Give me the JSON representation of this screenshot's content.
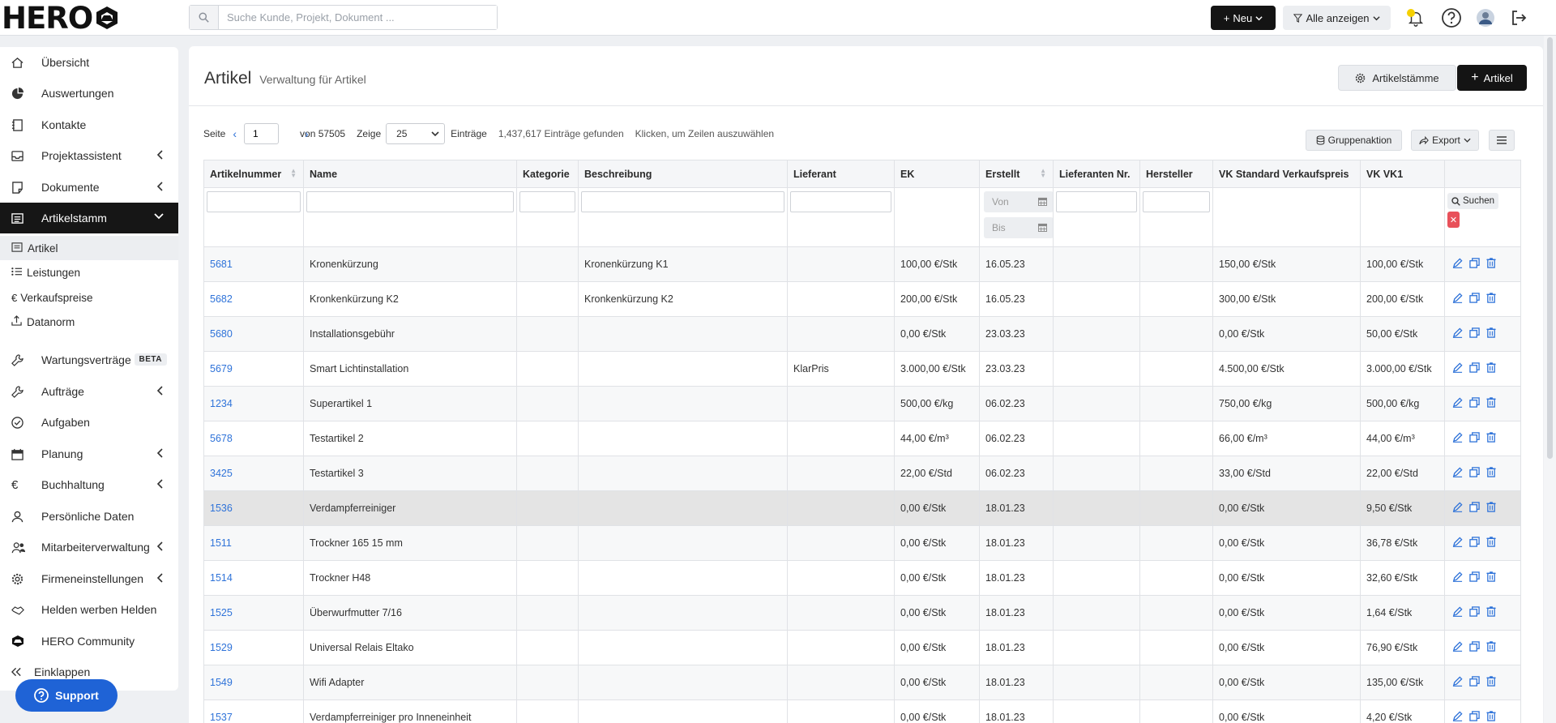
{
  "app": {
    "logo_text": "HERO"
  },
  "topbar": {
    "search_placeholder": "Suche Kunde, Projekt, Dokument ...",
    "new_label": "Neu",
    "filter_label": "Alle anzeigen"
  },
  "sidebar": {
    "overview": "Übersicht",
    "reports": "Auswertungen",
    "contacts": "Kontakte",
    "project_assistant": "Projektassistent",
    "documents": "Dokumente",
    "article_master": "Artikelstamm",
    "sub_articles": "Artikel",
    "sub_services": "Leistungen",
    "sub_prices": "Verkaufspreise",
    "sub_datanorm": "Datanorm",
    "maintenance": "Wartungsverträge",
    "beta_badge": "BETA",
    "orders": "Aufträge",
    "tasks": "Aufgaben",
    "planning": "Planung",
    "accounting": "Buchhaltung",
    "personal": "Persönliche Daten",
    "employees": "Mitarbeiterverwaltung",
    "company": "Firmeneinstellungen",
    "referral": "Helden werben Helden",
    "community": "HERO Community",
    "collapse": "Einklappen",
    "support": "Support"
  },
  "page": {
    "title": "Artikel",
    "subtitle": "Verwaltung für Artikel",
    "stamm_button": "Artikelstämme",
    "add_button": "Artikel"
  },
  "pager": {
    "page_label": "Seite",
    "page_value": "1",
    "of_label": "von 57505",
    "show_label": "Zeige",
    "per_page": "25",
    "entries_label": "Einträge",
    "found": "1,437,617 Einträge gefunden",
    "hint": "Klicken, um Zeilen auszuwählen",
    "group_action": "Gruppenaktion",
    "export": "Export"
  },
  "table": {
    "columns": [
      "Artikelnummer",
      "Name",
      "Kategorie",
      "Beschreibung",
      "Lieferant",
      "EK",
      "Erstellt",
      "Lieferanten Nr.",
      "Hersteller",
      "VK Standard Verkaufspreis",
      "VK VK1",
      ""
    ],
    "filter": {
      "from": "Von",
      "to": "Bis",
      "search": "Suchen"
    },
    "rows": [
      {
        "nr": "5681",
        "name": "Kronenkürzung",
        "kategorie": "",
        "beschreibung": "Kronenkürzung K1",
        "lieferant": "",
        "ek": "100,00 €/Stk",
        "erstellt": "16.05.23",
        "liefnr": "",
        "hersteller": "",
        "vk_std": "150,00 €/Stk",
        "vk1": "100,00 €/Stk"
      },
      {
        "nr": "5682",
        "name": "Kronkenkürzung K2",
        "kategorie": "",
        "beschreibung": "Kronkenkürzung K2",
        "lieferant": "",
        "ek": "200,00 €/Stk",
        "erstellt": "16.05.23",
        "liefnr": "",
        "hersteller": "",
        "vk_std": "300,00 €/Stk",
        "vk1": "200,00 €/Stk"
      },
      {
        "nr": "5680",
        "name": "Installationsgebühr",
        "kategorie": "",
        "beschreibung": "",
        "lieferant": "",
        "ek": "0,00 €/Stk",
        "erstellt": "23.03.23",
        "liefnr": "",
        "hersteller": "",
        "vk_std": "0,00 €/Stk",
        "vk1": "50,00 €/Stk"
      },
      {
        "nr": "5679",
        "name": "Smart Lichtinstallation",
        "kategorie": "",
        "beschreibung": "",
        "lieferant": "KlarPris",
        "ek": "3.000,00 €/Stk",
        "erstellt": "23.03.23",
        "liefnr": "",
        "hersteller": "",
        "vk_std": "4.500,00 €/Stk",
        "vk1": "3.000,00 €/Stk"
      },
      {
        "nr": "1234",
        "name": "Superartikel 1",
        "kategorie": "",
        "beschreibung": "",
        "lieferant": "",
        "ek": "500,00 €/kg",
        "erstellt": "06.02.23",
        "liefnr": "",
        "hersteller": "",
        "vk_std": "750,00 €/kg",
        "vk1": "500,00 €/kg"
      },
      {
        "nr": "5678",
        "name": "Testartikel 2",
        "kategorie": "",
        "beschreibung": "",
        "lieferant": "",
        "ek": "44,00 €/m³",
        "erstellt": "06.02.23",
        "liefnr": "",
        "hersteller": "",
        "vk_std": "66,00 €/m³",
        "vk1": "44,00 €/m³"
      },
      {
        "nr": "3425",
        "name": "Testartikel 3",
        "kategorie": "",
        "beschreibung": "",
        "lieferant": "",
        "ek": "22,00 €/Std",
        "erstellt": "06.02.23",
        "liefnr": "",
        "hersteller": "",
        "vk_std": "33,00 €/Std",
        "vk1": "22,00 €/Std"
      },
      {
        "nr": "1536",
        "name": "Verdampferreiniger",
        "kategorie": "",
        "beschreibung": "",
        "lieferant": "",
        "ek": "0,00 €/Stk",
        "erstellt": "18.01.23",
        "liefnr": "",
        "hersteller": "",
        "vk_std": "0,00 €/Stk",
        "vk1": "9,50 €/Stk"
      },
      {
        "nr": "1511",
        "name": "Trockner 165 15 mm",
        "kategorie": "",
        "beschreibung": "",
        "lieferant": "",
        "ek": "0,00 €/Stk",
        "erstellt": "18.01.23",
        "liefnr": "",
        "hersteller": "",
        "vk_std": "0,00 €/Stk",
        "vk1": "36,78 €/Stk"
      },
      {
        "nr": "1514",
        "name": "Trockner H48",
        "kategorie": "",
        "beschreibung": "",
        "lieferant": "",
        "ek": "0,00 €/Stk",
        "erstellt": "18.01.23",
        "liefnr": "",
        "hersteller": "",
        "vk_std": "0,00 €/Stk",
        "vk1": "32,60 €/Stk"
      },
      {
        "nr": "1525",
        "name": "Überwurfmutter 7/16",
        "kategorie": "",
        "beschreibung": "",
        "lieferant": "",
        "ek": "0,00 €/Stk",
        "erstellt": "18.01.23",
        "liefnr": "",
        "hersteller": "",
        "vk_std": "0,00 €/Stk",
        "vk1": "1,64 €/Stk"
      },
      {
        "nr": "1529",
        "name": "Universal Relais Eltako",
        "kategorie": "",
        "beschreibung": "",
        "lieferant": "",
        "ek": "0,00 €/Stk",
        "erstellt": "18.01.23",
        "liefnr": "",
        "hersteller": "",
        "vk_std": "0,00 €/Stk",
        "vk1": "76,90 €/Stk"
      },
      {
        "nr": "1549",
        "name": "Wifi Adapter",
        "kategorie": "",
        "beschreibung": "",
        "lieferant": "",
        "ek": "0,00 €/Stk",
        "erstellt": "18.01.23",
        "liefnr": "",
        "hersteller": "",
        "vk_std": "0,00 €/Stk",
        "vk1": "135,00 €/Stk"
      },
      {
        "nr": "1537",
        "name": "Verdampferreiniger pro Inneneinheit",
        "kategorie": "",
        "beschreibung": "",
        "lieferant": "",
        "ek": "0,00 €/Stk",
        "erstellt": "18.01.23",
        "liefnr": "",
        "hersteller": "",
        "vk_std": "0,00 €/Stk",
        "vk1": "4,20 €/Stk"
      }
    ],
    "highlighted_row": 7
  },
  "colors": {
    "accent_blue": "#2f73d9",
    "active_nav": "#161616",
    "support_blue": "#1f63d6",
    "danger": "#e8515a"
  }
}
